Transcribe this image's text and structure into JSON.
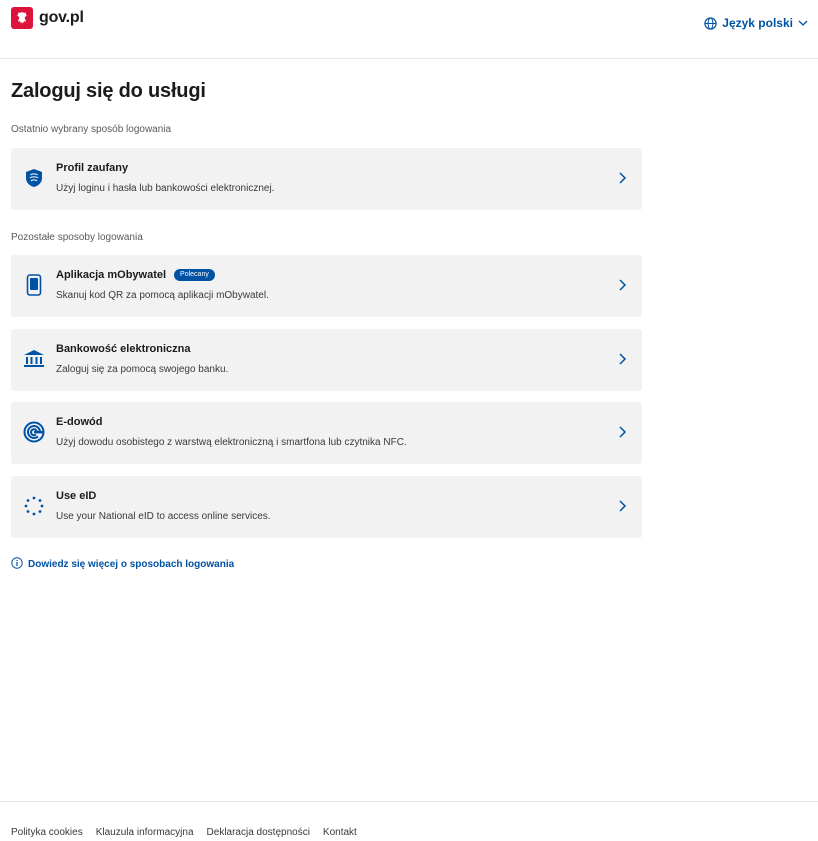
{
  "header": {
    "logo_text": "gov.pl",
    "language_label": "Język polski"
  },
  "main": {
    "title": "Zaloguj się do usługi",
    "recent_label": "Ostatnio wybrany sposób logowania",
    "recent": [
      {
        "title": "Profil zaufany",
        "desc": "Użyj loginu i hasła lub bankowości elektronicznej.",
        "icon": "trusted-profile-icon"
      }
    ],
    "other_label": "Pozostałe sposoby logowania",
    "methods": [
      {
        "title": "Aplikacja mObywatel",
        "badge": "Polecany",
        "desc": "Skanuj kod QR za pomocą aplikacji mObywatel.",
        "icon": "phone-icon"
      },
      {
        "title": "Bankowość elektroniczna",
        "desc": "Zaloguj się za pomocą swojego banku.",
        "icon": "bank-icon"
      },
      {
        "title": "E-dowód",
        "desc": "Użyj dowodu osobistego z warstwą elektroniczną i smartfona lub czytnika NFC.",
        "icon": "e-id-card-icon"
      },
      {
        "title": "Use eID",
        "desc": "Use your National eID to access online services.",
        "icon": "eu-stars-icon"
      }
    ],
    "learn_more": "Dowiedz się więcej o sposobach logowania"
  },
  "footer": {
    "links": [
      "Polityka cookies",
      "Klauzula informacyjna",
      "Deklaracja dostępności",
      "Kontakt"
    ]
  },
  "colors": {
    "accent": "#0052a5",
    "brand_red": "#dc143c",
    "card_bg": "#f2f2f2"
  }
}
